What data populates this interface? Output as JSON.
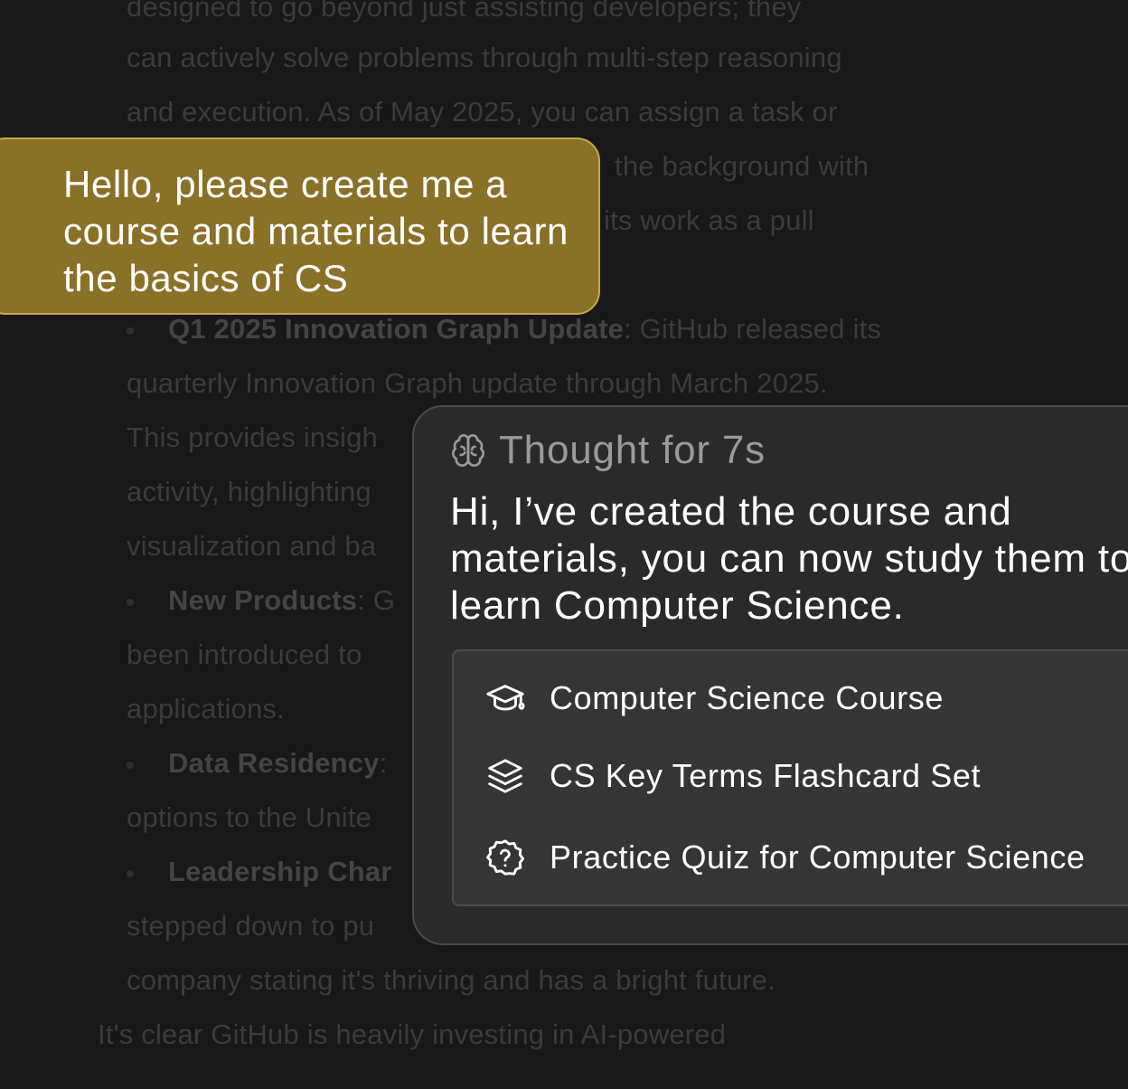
{
  "background_document": {
    "lines": [
      "designed to go beyond just assisting developers; they",
      "can actively solve problems through multi-step reasoning",
      "and execution. As of May 2025, you can assign a task or",
      "the background with",
      "its work as a pull",
      "",
      ": GitHub released its",
      "quarterly Innovation Graph update through March 2025.",
      "This provides insigh",
      "activity, highlighting",
      "visualization and ba",
      ": G",
      "been introduced to",
      "applications.",
      ":",
      "options to the Unite",
      "",
      "stepped down to pu",
      "company stating it's thriving and has a bright future.",
      "It's clear GitHub is heavily investing in AI-powered"
    ],
    "bold_terms": [
      "Q1 2025 Innovation Graph Update",
      "New Products",
      "Data Residency",
      "Leadership Char"
    ]
  },
  "user_message": {
    "text": "Hello, please create me a course and materials to learn the basics of CS"
  },
  "assistant": {
    "thought_label": "Thought for 7s",
    "thought_icon": "brain-icon",
    "reply": "Hi, I’ve created the course and materials, you can now study them to learn Computer Science.",
    "materials": [
      {
        "icon": "graduation-cap-icon",
        "label": "Computer Science Course"
      },
      {
        "icon": "layers-icon",
        "label": "CS Key Terms Flashcard Set"
      },
      {
        "icon": "quiz-badge-icon",
        "label": "Practice Quiz for Computer Science"
      }
    ]
  },
  "colors": {
    "page_background": "#181818",
    "user_bubble": "#8a7128",
    "user_bubble_border": "#c7a84a",
    "assistant_card": "#2a2a2a",
    "materials_box": "#353535",
    "faded_text": "#3b3b3b"
  }
}
